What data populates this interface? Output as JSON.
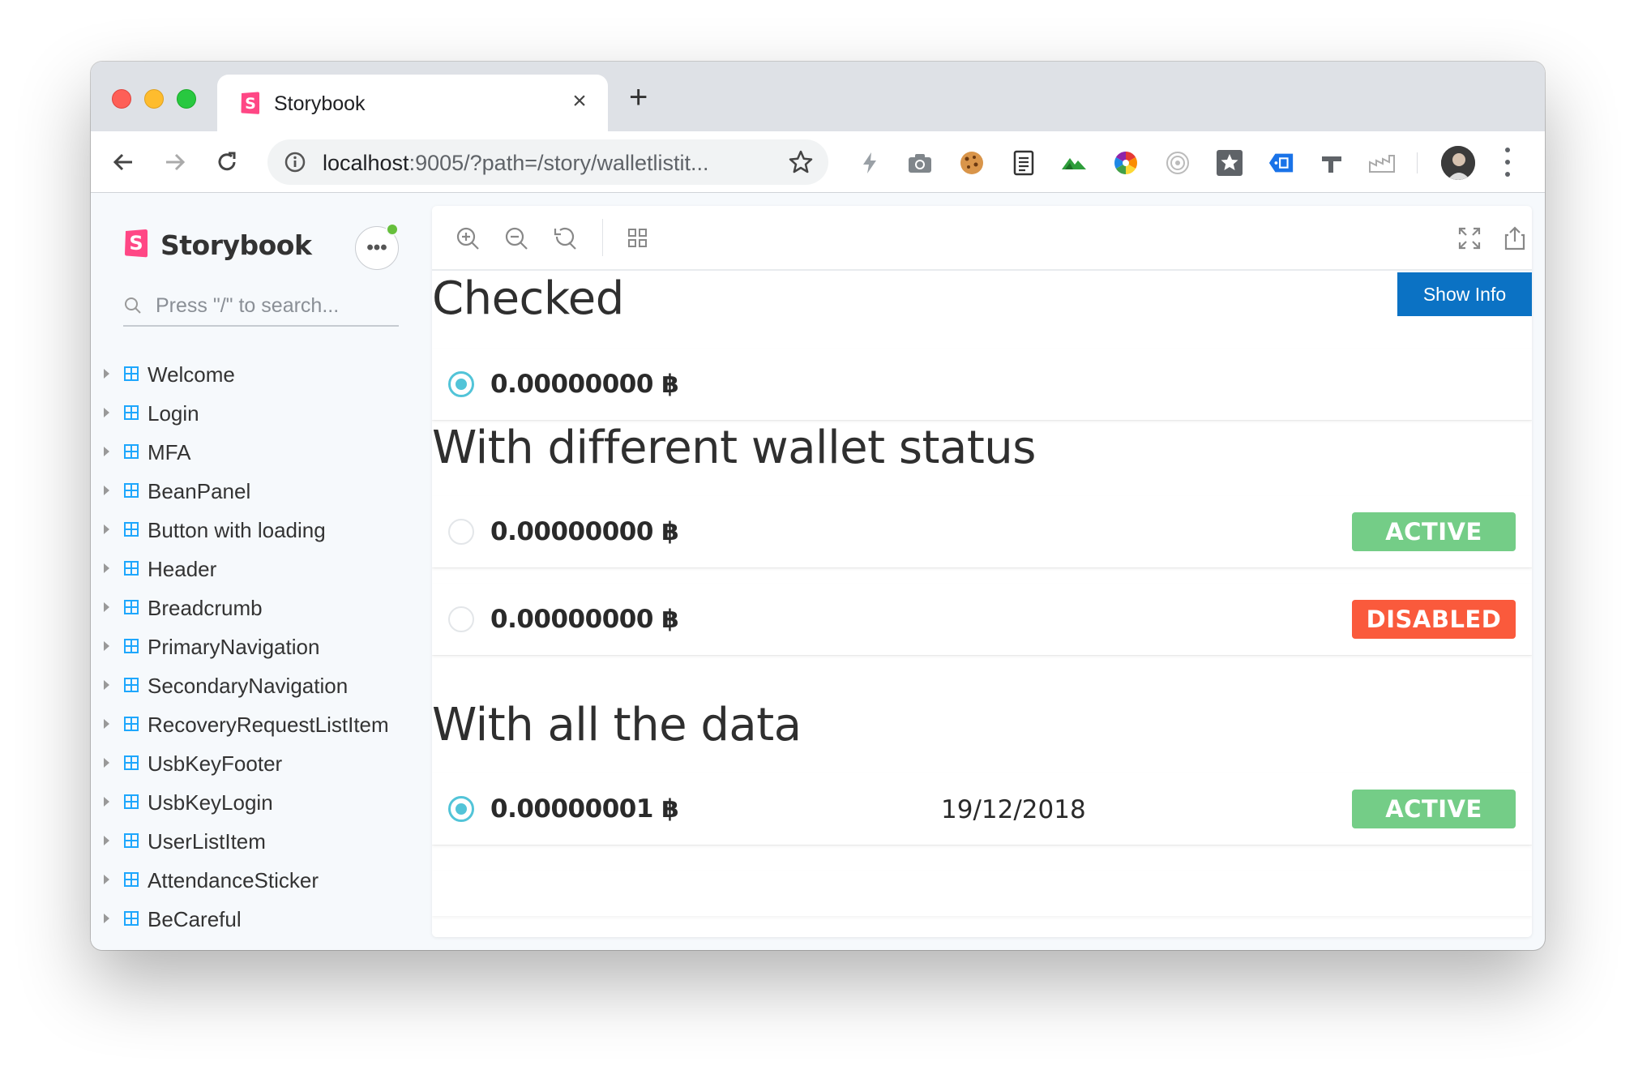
{
  "browser": {
    "tab_title": "Storybook",
    "new_tab_symbol": "+",
    "close_symbol": "×",
    "url_host": "localhost",
    "url_rest": ":9005/?path=/story/walletlistit..."
  },
  "sidebar": {
    "brand": "Storybook",
    "menu_symbol": "•••",
    "search_placeholder": "Press \"/\" to search...",
    "items": [
      {
        "label": "Welcome"
      },
      {
        "label": "Login"
      },
      {
        "label": "MFA"
      },
      {
        "label": "BeanPanel"
      },
      {
        "label": "Button with loading"
      },
      {
        "label": "Header"
      },
      {
        "label": "Breadcrumb"
      },
      {
        "label": "PrimaryNavigation"
      },
      {
        "label": "SecondaryNavigation"
      },
      {
        "label": "RecoveryRequestListItem"
      },
      {
        "label": "UsbKeyFooter"
      },
      {
        "label": "UsbKeyLogin"
      },
      {
        "label": "UserListItem"
      },
      {
        "label": "AttendanceSticker"
      },
      {
        "label": "BeCareful"
      }
    ]
  },
  "preview": {
    "show_info": "Show Info",
    "sections": [
      {
        "heading": "Checked",
        "rows": [
          {
            "checked": true,
            "amount": "0.00000000 ฿",
            "date": "",
            "status": ""
          }
        ]
      },
      {
        "heading": "With different wallet status",
        "rows": [
          {
            "checked": false,
            "amount": "0.00000000 ฿",
            "date": "",
            "status": "ACTIVE"
          },
          {
            "checked": false,
            "amount": "0.00000000 ฿",
            "date": "",
            "status": "DISABLED"
          }
        ]
      },
      {
        "heading": "With all the data",
        "rows": [
          {
            "checked": true,
            "amount": "0.00000001 ฿",
            "date": "19/12/2018",
            "status": "ACTIVE"
          }
        ]
      }
    ]
  },
  "colors": {
    "accent_blue": "#0b72c4",
    "active_green": "#74cd87",
    "disabled_red": "#fa5a3c",
    "radio_cyan": "#52c4d8",
    "storybook_pink": "#ff4785"
  }
}
